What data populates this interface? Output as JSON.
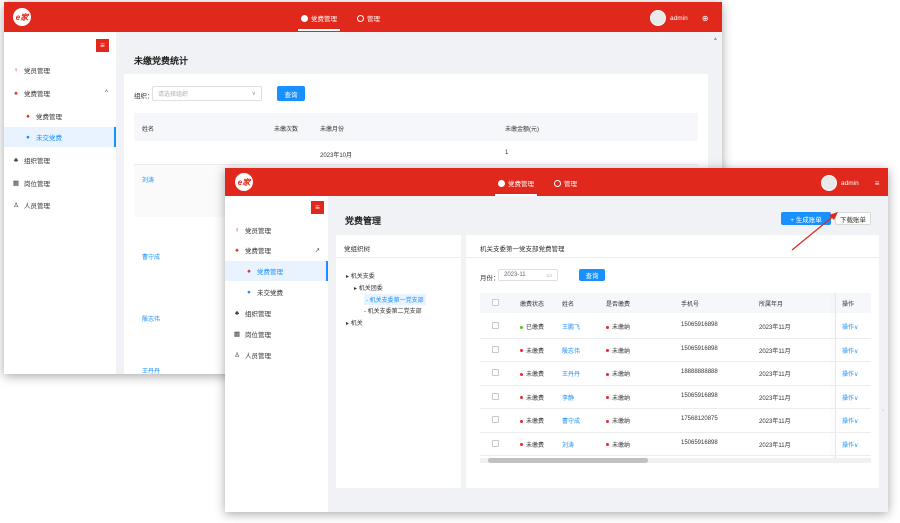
{
  "back": {
    "logo": "e家",
    "nav": [
      {
        "label": "党费管理",
        "icon": "party-fee-icon"
      },
      {
        "label": "管理",
        "icon": "manage-icon"
      }
    ],
    "user": {
      "name": "admin"
    },
    "sidebar": {
      "toggle": "≡",
      "items": [
        {
          "label": "党员管理",
          "icon": "♀"
        },
        {
          "label": "党费管理",
          "icon": "♠",
          "chevron": "^"
        },
        {
          "label": "党费管理",
          "icon": "♠"
        },
        {
          "label": "未交党费",
          "icon": "●"
        },
        {
          "label": "组织管理",
          "icon": "♣"
        },
        {
          "label": "岗位管理",
          "icon": "▦"
        },
        {
          "label": "人员管理",
          "icon": "♙"
        }
      ]
    },
    "page_title": "未缴党费统计",
    "filter": {
      "label": "组织：",
      "placeholder": "请选择组织",
      "button": "查询"
    },
    "table": {
      "headers": [
        "姓名",
        "未缴次数",
        "未缴月份",
        "未缴金额(元)"
      ],
      "first_row": {
        "month": "2023年10月",
        "amount": "1"
      },
      "names": [
        "刘涛",
        "曹守成",
        "殷志伟",
        "王丹丹"
      ]
    }
  },
  "front": {
    "logo": "e家",
    "nav": [
      {
        "label": "党费管理",
        "icon": "party-fee-icon"
      },
      {
        "label": "管理",
        "icon": "manage-icon"
      }
    ],
    "user": {
      "name": "admin",
      "menu_icon": "≡"
    },
    "sidebar": {
      "toggle": "≡",
      "items": [
        {
          "label": "党员管理",
          "icon": "♀"
        },
        {
          "label": "党费管理",
          "icon": "♠",
          "chevron": "↗"
        },
        {
          "label": "党费管理",
          "icon": "♠"
        },
        {
          "label": "未交党费",
          "icon": "●"
        },
        {
          "label": "组织管理",
          "icon": "♣"
        },
        {
          "label": "岗位管理",
          "icon": "▦"
        },
        {
          "label": "人员管理",
          "icon": "♙"
        }
      ]
    },
    "page_title": "党费管理",
    "buttons": {
      "generate": "+ 生成账单",
      "download": "下载账单"
    },
    "tree": {
      "title": "党组织树",
      "nodes": [
        "机关支委",
        "机关团委",
        "机关支委第一党支部",
        "机关支委第二党支部",
        "机关"
      ]
    },
    "panel": {
      "title": "机关支委第一党支部党费管理",
      "month_label": "月份：",
      "month_value": "2023-11",
      "query": "查询"
    },
    "table": {
      "headers": [
        "缴费状态",
        "姓名",
        "是否缴费",
        "手机号",
        "所属年月",
        "操作"
      ],
      "rows": [
        {
          "status": "已缴费",
          "status_color": "#52c41a",
          "name": "王鹏飞",
          "paid": "未缴纳",
          "phone": "15065916898",
          "month": "2023年11月",
          "op": "操作∨"
        },
        {
          "status": "未缴费",
          "status_color": "#f5222d",
          "name": "殷志伟",
          "paid": "未缴纳",
          "phone": "15065916898",
          "month": "2023年11月",
          "op": "操作∨"
        },
        {
          "status": "未缴费",
          "status_color": "#f5222d",
          "name": "王丹丹",
          "paid": "未缴纳",
          "phone": "18888888888",
          "month": "2023年11月",
          "op": "操作∨"
        },
        {
          "status": "未缴费",
          "status_color": "#f5222d",
          "name": "李静",
          "paid": "未缴纳",
          "phone": "15065916898",
          "month": "2023年11月",
          "op": "操作∨"
        },
        {
          "status": "未缴费",
          "status_color": "#f5222d",
          "name": "曹守成",
          "paid": "未缴纳",
          "phone": "17568120875",
          "month": "2023年11月",
          "op": "操作∨"
        },
        {
          "status": "未缴费",
          "status_color": "#f5222d",
          "name": "刘涛",
          "paid": "未缴纳",
          "phone": "15065916898",
          "month": "2023年11月",
          "op": "操作∨"
        }
      ]
    }
  },
  "colors": {
    "brand_red": "#e0281c",
    "accent_blue": "#1890ff",
    "annotation_arrow": "#e0281c"
  }
}
